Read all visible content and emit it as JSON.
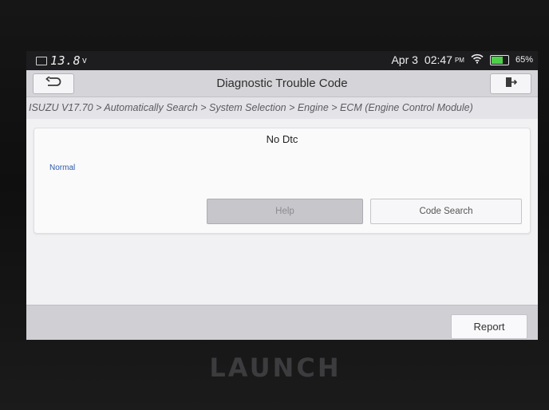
{
  "status_bar": {
    "voltage": "13.8",
    "voltage_unit": "v",
    "date": "Apr 3",
    "time": "02:47",
    "ampm": "PM",
    "battery_percent": "65%",
    "battery_level": 0.65,
    "battery_color": "#4fd04a"
  },
  "header": {
    "title": "Diagnostic Trouble Code",
    "back_icon": "back-arrow-icon",
    "exit_icon": "exit-icon"
  },
  "breadcrumb": "ISUZU V17.70 > Automatically Search > System Selection > Engine > ECM (Engine Control Module)",
  "result": {
    "dtc_text": "No Dtc",
    "status": "Normal",
    "status_color": "#2f5aa8"
  },
  "buttons": {
    "help": "Help",
    "code_search": "Code Search",
    "report": "Report"
  },
  "device": {
    "brand": "LAUNCH"
  }
}
